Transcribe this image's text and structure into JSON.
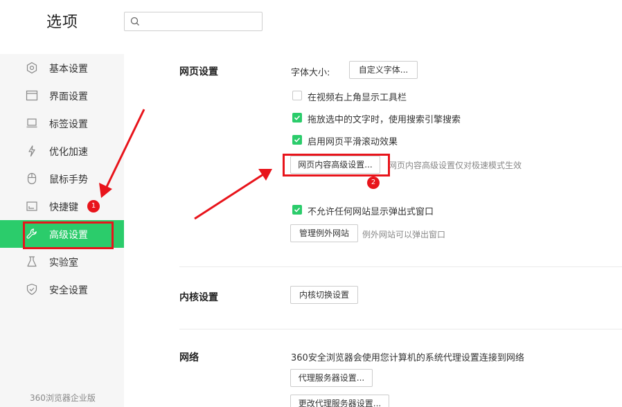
{
  "header": {
    "title": "选项",
    "search": {
      "placeholder": "",
      "value": "",
      "icon": "search-icon"
    }
  },
  "sidebar": {
    "items": [
      {
        "label": "基本设置",
        "icon": "gear-icon",
        "active": false
      },
      {
        "label": "界面设置",
        "icon": "window-icon",
        "active": false
      },
      {
        "label": "标签设置",
        "icon": "tab-icon",
        "active": false
      },
      {
        "label": "优化加速",
        "icon": "lightning-icon",
        "active": false
      },
      {
        "label": "鼠标手势",
        "icon": "mouse-icon",
        "active": false
      },
      {
        "label": "快捷键",
        "icon": "keyboard-icon",
        "active": false
      },
      {
        "label": "高级设置",
        "icon": "wrench-icon",
        "active": true
      },
      {
        "label": "实验室",
        "icon": "flask-icon",
        "active": false
      },
      {
        "label": "安全设置",
        "icon": "shield-icon",
        "active": false
      }
    ],
    "edition": "360浏览器企业版"
  },
  "webpage_settings": {
    "title": "网页设置",
    "font_size_label": "字体大小:",
    "custom_font_button": "自定义字体...",
    "checkboxes": [
      {
        "label": "在视频右上角显示工具栏",
        "checked": false
      },
      {
        "label": "拖放选中的文字时，使用搜索引擎搜索",
        "checked": true
      },
      {
        "label": "启用网页平滑滚动效果",
        "checked": true
      }
    ],
    "advanced_content_button": "网页内容高级设置...",
    "advanced_content_hint": "网页内容高级设置仅对极速模式生效",
    "popup_checkbox": {
      "label": "不允许任何网站显示弹出式窗口",
      "checked": true
    },
    "manage_exceptions_button": "管理例外网站",
    "manage_exceptions_hint": "例外网站可以弹出窗口"
  },
  "kernel_settings": {
    "title": "内核设置",
    "switch_button": "内核切换设置"
  },
  "network": {
    "title": "网络",
    "description": "360安全浏览器会使用您计算机的系统代理设置连接到网络",
    "proxy_button": "代理服务器设置...",
    "change_proxy_button": "更改代理服务器设置..."
  },
  "annotations": {
    "badge_1": "1",
    "badge_2": "2",
    "color": "#e8141b"
  },
  "colors": {
    "accent": "#2bcc6b",
    "annotation": "#e8141b"
  }
}
